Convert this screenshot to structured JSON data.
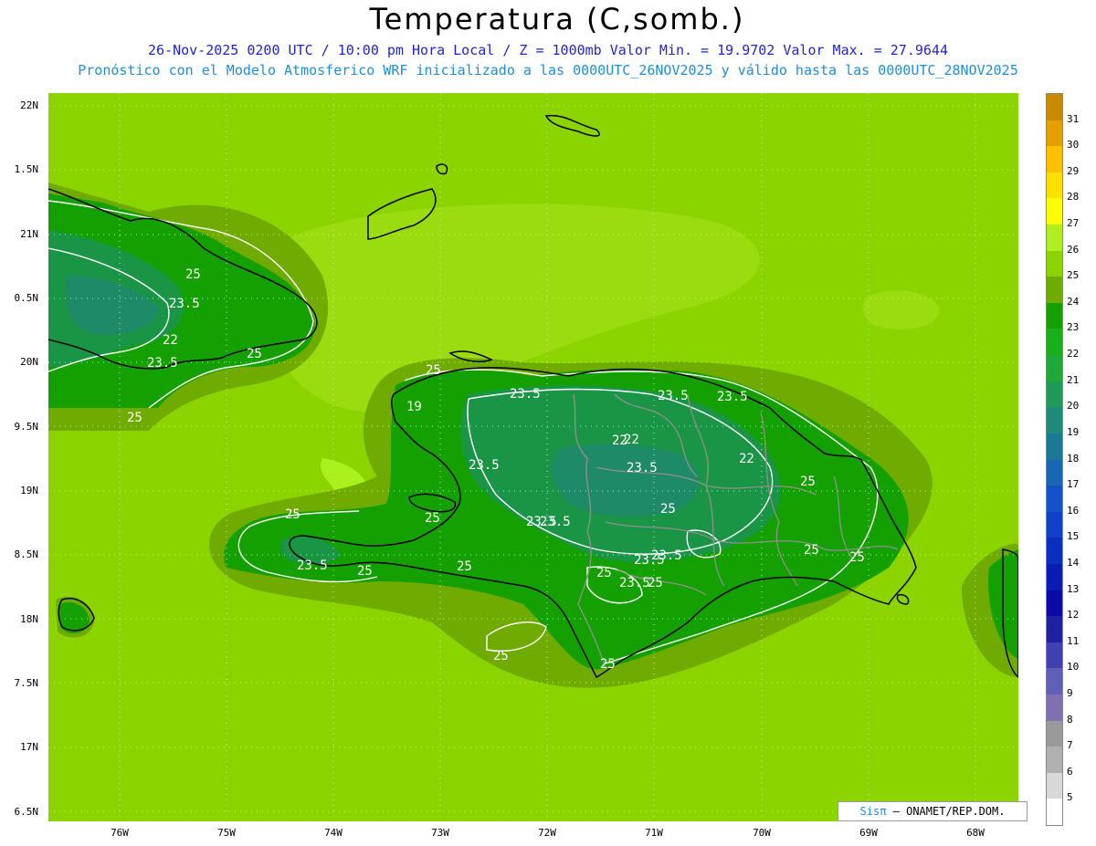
{
  "title": "Temperatura (C,somb.)",
  "subtitle_line1": "26-Nov-2025 0200 UTC / 10:00 pm Hora Local / Z = 1000mb  Valor Min. = 19.9702  Valor Max. = 27.9644",
  "subtitle_line2": "Pronóstico con el Modelo Atmosferico WRF inicializado a las 0000UTC_26NOV2025 y válido hasta las  0000UTC_28NOV2025",
  "lat_labels": [
    "22N",
    "1.5N",
    "21N",
    "0.5N",
    "20N",
    "9.5N",
    "19N",
    "8.5N",
    "18N",
    "7.5N",
    "17N",
    "6.5N"
  ],
  "lon_labels": [
    "76W",
    "75W",
    "74W",
    "73W",
    "72W",
    "71W",
    "70W",
    "69W",
    "68W"
  ],
  "colorbar": {
    "labels": [
      "31",
      "30",
      "29",
      "28",
      "27",
      "26",
      "25",
      "24",
      "23",
      "22",
      "21",
      "20",
      "19",
      "18",
      "17",
      "16",
      "15",
      "14",
      "13",
      "12",
      "11",
      "10",
      "9",
      "8",
      "7",
      "6",
      "5"
    ],
    "colors": [
      "#c88a00",
      "#e5a000",
      "#ffc000",
      "#ffe000",
      "#ffff00",
      "#b0ee20",
      "#8cd400",
      "#6fab00",
      "#14a000",
      "#18b018",
      "#20a838",
      "#209a58",
      "#208b78",
      "#1a7a96",
      "#1866b4",
      "#1452c8",
      "#1040c8",
      "#0a2ec0",
      "#0a1cb4",
      "#0a0aa8",
      "#2020a0",
      "#4040b0",
      "#6060b8",
      "#8070b0",
      "#9a9a9a",
      "#b0b0b0",
      "#d8d8d8",
      "#ffffff"
    ]
  },
  "map_colors": {
    "ocean": "#8cd400",
    "halo_light": "#b0ee20",
    "band_25_26": "#6fab00",
    "band_24_25": "#14a000",
    "band_22_24": "#1e9a3c",
    "band_lt_22": "#208b66",
    "contour_line": "#ffffff",
    "coastline": "#000000",
    "province_border": "#909090"
  },
  "contour_labels": [
    {
      "text": "25"
    },
    {
      "text": "23.5"
    },
    {
      "text": "22"
    },
    {
      "text": "23.5"
    },
    {
      "text": "25"
    },
    {
      "text": "25"
    },
    {
      "text": "25"
    },
    {
      "text": "23.5"
    },
    {
      "text": "19"
    },
    {
      "text": "23.5"
    },
    {
      "text": "22"
    },
    {
      "text": "23.5"
    },
    {
      "text": "23.5"
    },
    {
      "text": "22"
    },
    {
      "text": "23.5"
    },
    {
      "text": "22"
    },
    {
      "text": "25"
    },
    {
      "text": "23.5"
    },
    {
      "text": "25"
    },
    {
      "text": "23.5"
    },
    {
      "text": "25"
    },
    {
      "text": "25"
    },
    {
      "text": "23.5"
    },
    {
      "text": "25"
    },
    {
      "text": "25"
    },
    {
      "text": "25"
    },
    {
      "text": "23.5"
    },
    {
      "text": "25"
    },
    {
      "text": "23.5"
    },
    {
      "text": "25"
    },
    {
      "text": "25"
    },
    {
      "text": "25"
    },
    {
      "text": "23.5"
    },
    {
      "text": "25"
    }
  ],
  "credit": {
    "sis": "Sisπ",
    "rest": " – ONAMET/REP.DOM."
  }
}
